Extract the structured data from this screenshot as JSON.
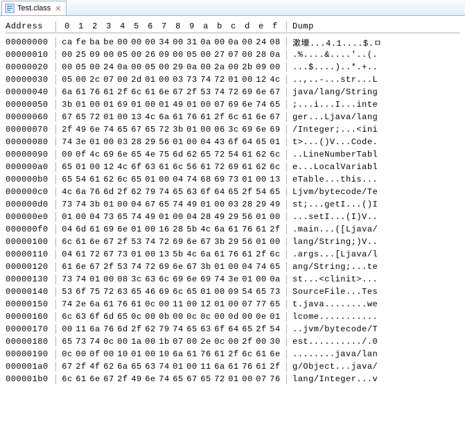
{
  "tab": {
    "filename": "Test.class",
    "close_glyph": "✕"
  },
  "header": {
    "address_label": "Address",
    "cols": [
      "0",
      "1",
      "2",
      "3",
      "4",
      "5",
      "6",
      "7",
      "8",
      "9",
      "a",
      "b",
      "c",
      "d",
      "e",
      "f"
    ],
    "dump_label": "Dump"
  },
  "rows": [
    {
      "addr": "00000000",
      "hex": [
        "ca",
        "fe",
        "ba",
        "be",
        "00",
        "00",
        "00",
        "34",
        "00",
        "31",
        "0a",
        "00",
        "0a",
        "00",
        "24",
        "08"
      ],
      "dump": "漱壕...4.1....$.ㅁ"
    },
    {
      "addr": "00000010",
      "hex": [
        "00",
        "25",
        "09",
        "00",
        "05",
        "00",
        "26",
        "09",
        "00",
        "05",
        "00",
        "27",
        "07",
        "00",
        "28",
        "0a"
      ],
      "dump": ".%....&....'..(."
    },
    {
      "addr": "00000020",
      "hex": [
        "00",
        "05",
        "00",
        "24",
        "0a",
        "00",
        "05",
        "00",
        "29",
        "0a",
        "00",
        "2a",
        "00",
        "2b",
        "09",
        "00"
      ],
      "dump": "...$....)..*.+.."
    },
    {
      "addr": "00000030",
      "hex": [
        "05",
        "00",
        "2c",
        "07",
        "00",
        "2d",
        "01",
        "00",
        "03",
        "73",
        "74",
        "72",
        "01",
        "00",
        "12",
        "4c"
      ],
      "dump": "..,..-...str...L"
    },
    {
      "addr": "00000040",
      "hex": [
        "6a",
        "61",
        "76",
        "61",
        "2f",
        "6c",
        "61",
        "6e",
        "67",
        "2f",
        "53",
        "74",
        "72",
        "69",
        "6e",
        "67"
      ],
      "dump": "java/lang/String"
    },
    {
      "addr": "00000050",
      "hex": [
        "3b",
        "01",
        "00",
        "01",
        "69",
        "01",
        "00",
        "01",
        "49",
        "01",
        "00",
        "07",
        "69",
        "6e",
        "74",
        "65"
      ],
      "dump": ";...i...I...inte"
    },
    {
      "addr": "00000060",
      "hex": [
        "67",
        "65",
        "72",
        "01",
        "00",
        "13",
        "4c",
        "6a",
        "61",
        "76",
        "61",
        "2f",
        "6c",
        "61",
        "6e",
        "67"
      ],
      "dump": "ger...Ljava/lang"
    },
    {
      "addr": "00000070",
      "hex": [
        "2f",
        "49",
        "6e",
        "74",
        "65",
        "67",
        "65",
        "72",
        "3b",
        "01",
        "00",
        "06",
        "3c",
        "69",
        "6e",
        "69"
      ],
      "dump": "/Integer;...<ini"
    },
    {
      "addr": "00000080",
      "hex": [
        "74",
        "3e",
        "01",
        "00",
        "03",
        "28",
        "29",
        "56",
        "01",
        "00",
        "04",
        "43",
        "6f",
        "64",
        "65",
        "01"
      ],
      "dump": "t>...()V...Code."
    },
    {
      "addr": "00000090",
      "hex": [
        "00",
        "0f",
        "4c",
        "69",
        "6e",
        "65",
        "4e",
        "75",
        "6d",
        "62",
        "65",
        "72",
        "54",
        "61",
        "62",
        "6c"
      ],
      "dump": "..LineNumberTabl"
    },
    {
      "addr": "000000a0",
      "hex": [
        "65",
        "01",
        "00",
        "12",
        "4c",
        "6f",
        "63",
        "61",
        "6c",
        "56",
        "61",
        "72",
        "69",
        "61",
        "62",
        "6c"
      ],
      "dump": "e...LocalVariabl"
    },
    {
      "addr": "000000b0",
      "hex": [
        "65",
        "54",
        "61",
        "62",
        "6c",
        "65",
        "01",
        "00",
        "04",
        "74",
        "68",
        "69",
        "73",
        "01",
        "00",
        "13"
      ],
      "dump": "eTable...this..."
    },
    {
      "addr": "000000c0",
      "hex": [
        "4c",
        "6a",
        "76",
        "6d",
        "2f",
        "62",
        "79",
        "74",
        "65",
        "63",
        "6f",
        "64",
        "65",
        "2f",
        "54",
        "65"
      ],
      "dump": "Ljvm/bytecode/Te"
    },
    {
      "addr": "000000d0",
      "hex": [
        "73",
        "74",
        "3b",
        "01",
        "00",
        "04",
        "67",
        "65",
        "74",
        "49",
        "01",
        "00",
        "03",
        "28",
        "29",
        "49"
      ],
      "dump": "st;...getI...()I"
    },
    {
      "addr": "000000e0",
      "hex": [
        "01",
        "00",
        "04",
        "73",
        "65",
        "74",
        "49",
        "01",
        "00",
        "04",
        "28",
        "49",
        "29",
        "56",
        "01",
        "00"
      ],
      "dump": "...setI...(I)V.."
    },
    {
      "addr": "000000f0",
      "hex": [
        "04",
        "6d",
        "61",
        "69",
        "6e",
        "01",
        "00",
        "16",
        "28",
        "5b",
        "4c",
        "6a",
        "61",
        "76",
        "61",
        "2f"
      ],
      "dump": ".main...([Ljava/"
    },
    {
      "addr": "00000100",
      "hex": [
        "6c",
        "61",
        "6e",
        "67",
        "2f",
        "53",
        "74",
        "72",
        "69",
        "6e",
        "67",
        "3b",
        "29",
        "56",
        "01",
        "00"
      ],
      "dump": "lang/String;)V.."
    },
    {
      "addr": "00000110",
      "hex": [
        "04",
        "61",
        "72",
        "67",
        "73",
        "01",
        "00",
        "13",
        "5b",
        "4c",
        "6a",
        "61",
        "76",
        "61",
        "2f",
        "6c"
      ],
      "dump": ".args...[Ljava/l"
    },
    {
      "addr": "00000120",
      "hex": [
        "61",
        "6e",
        "67",
        "2f",
        "53",
        "74",
        "72",
        "69",
        "6e",
        "67",
        "3b",
        "01",
        "00",
        "04",
        "74",
        "65"
      ],
      "dump": "ang/String;...te"
    },
    {
      "addr": "00000130",
      "hex": [
        "73",
        "74",
        "01",
        "00",
        "08",
        "3c",
        "63",
        "6c",
        "69",
        "6e",
        "69",
        "74",
        "3e",
        "01",
        "00",
        "0a"
      ],
      "dump": "st...<clinit>..."
    },
    {
      "addr": "00000140",
      "hex": [
        "53",
        "6f",
        "75",
        "72",
        "63",
        "65",
        "46",
        "69",
        "6c",
        "65",
        "01",
        "00",
        "09",
        "54",
        "65",
        "73"
      ],
      "dump": "SourceFile...Tes"
    },
    {
      "addr": "00000150",
      "hex": [
        "74",
        "2e",
        "6a",
        "61",
        "76",
        "61",
        "0c",
        "00",
        "11",
        "00",
        "12",
        "01",
        "00",
        "07",
        "77",
        "65"
      ],
      "dump": "t.java........we"
    },
    {
      "addr": "00000160",
      "hex": [
        "6c",
        "63",
        "6f",
        "6d",
        "65",
        "0c",
        "00",
        "0b",
        "00",
        "0c",
        "0c",
        "00",
        "0d",
        "00",
        "0e",
        "01"
      ],
      "dump": "lcome..........."
    },
    {
      "addr": "00000170",
      "hex": [
        "00",
        "11",
        "6a",
        "76",
        "6d",
        "2f",
        "62",
        "79",
        "74",
        "65",
        "63",
        "6f",
        "64",
        "65",
        "2f",
        "54"
      ],
      "dump": "..jvm/bytecode/T"
    },
    {
      "addr": "00000180",
      "hex": [
        "65",
        "73",
        "74",
        "0c",
        "00",
        "1a",
        "00",
        "1b",
        "07",
        "00",
        "2e",
        "0c",
        "00",
        "2f",
        "00",
        "30"
      ],
      "dump": "est........../.0"
    },
    {
      "addr": "00000190",
      "hex": [
        "0c",
        "00",
        "0f",
        "00",
        "10",
        "01",
        "00",
        "10",
        "6a",
        "61",
        "76",
        "61",
        "2f",
        "6c",
        "61",
        "6e"
      ],
      "dump": "........java/lan"
    },
    {
      "addr": "000001a0",
      "hex": [
        "67",
        "2f",
        "4f",
        "62",
        "6a",
        "65",
        "63",
        "74",
        "01",
        "00",
        "11",
        "6a",
        "61",
        "76",
        "61",
        "2f"
      ],
      "dump": "g/Object...java/"
    },
    {
      "addr": "000001b0",
      "hex": [
        "6c",
        "61",
        "6e",
        "67",
        "2f",
        "49",
        "6e",
        "74",
        "65",
        "67",
        "65",
        "72",
        "01",
        "00",
        "07",
        "76"
      ],
      "dump": "lang/Integer...v"
    }
  ],
  "watermark": ""
}
